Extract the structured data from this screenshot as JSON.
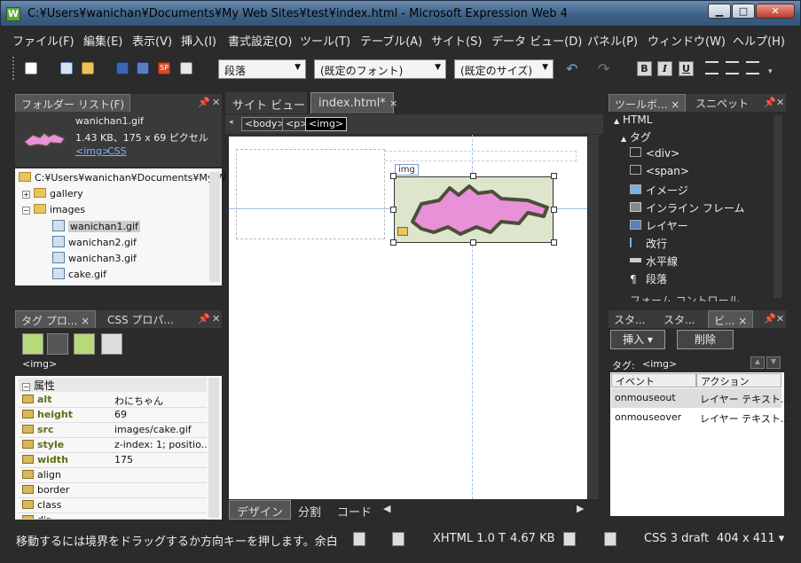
{
  "window": {
    "title": "C:¥Users¥wanichan¥Documents¥My Web Sites¥test¥index.html - Microsoft Expression Web 4",
    "app_icon_glyph": "W",
    "minimize": "▁",
    "maximize": "□",
    "close": "✕"
  },
  "menu": [
    "ファイル(F)",
    "編集(E)",
    "表示(V)",
    "挿入(I)",
    "書式設定(O)",
    "ツール(T)",
    "テーブル(A)",
    "サイト(S)",
    "データ ビュー(D)",
    "パネル(P)",
    "ウィンドウ(W)",
    "ヘルプ(H)"
  ],
  "toolbar": {
    "paragraph_combo": "段落",
    "font_combo": "(既定のフォント)",
    "size_combo": "(既定のサイズ)",
    "bold": "B",
    "italic": "I",
    "underline": "U",
    "overflow": "▾"
  },
  "folder_panel": {
    "tab": "フォルダー リスト(F)",
    "preview": {
      "filename": "wanichan1.gif",
      "info": "1.43 KB、175 x 69 ピクセル",
      "tag_link": "<img>",
      "css_link": "CSS"
    },
    "tree": [
      {
        "label": "C:¥Users¥wanichan¥Documents¥My W",
        "type": "folder-root"
      },
      {
        "label": "gallery",
        "type": "folder",
        "expander": "+"
      },
      {
        "label": "images",
        "type": "folder",
        "expander": "−"
      },
      {
        "label": "wanichan1.gif",
        "type": "file",
        "selected": true
      },
      {
        "label": "wanichan2.gif",
        "type": "file"
      },
      {
        "label": "wanichan3.gif",
        "type": "file"
      },
      {
        "label": "cake.gif",
        "type": "file"
      }
    ]
  },
  "tag_panel": {
    "tabs": [
      "タグ プロ...",
      "CSS プロパ..."
    ],
    "tag": "<img>",
    "group": "属性",
    "group_expander": "−",
    "rows": [
      {
        "name": "alt",
        "value": "わにちゃん",
        "bold": true
      },
      {
        "name": "height",
        "value": "69",
        "bold": true
      },
      {
        "name": "src",
        "value": "images/cake.gif",
        "bold": true
      },
      {
        "name": "style",
        "value": "z-index: 1; positio...",
        "bold": true
      },
      {
        "name": "width",
        "value": "175",
        "bold": true
      },
      {
        "name": "align",
        "value": "",
        "bold": false
      },
      {
        "name": "border",
        "value": "",
        "bold": false
      },
      {
        "name": "class",
        "value": "",
        "bold": false
      },
      {
        "name": "dir",
        "value": "",
        "bold": false
      }
    ]
  },
  "editor": {
    "tabs": [
      {
        "label": "サイト ビュー",
        "active": false
      },
      {
        "label": "index.html*",
        "active": true
      }
    ],
    "tab_close": "×",
    "breadcrumb": [
      "<body>",
      "<p>",
      "<img>"
    ],
    "image_label": "img",
    "view_tabs": [
      "デザイン",
      "分割",
      "コード"
    ]
  },
  "toolbox_panel": {
    "tabs": [
      "ツールボ...",
      "スニペット"
    ],
    "sections": [
      {
        "label": "HTML",
        "expander": "▲"
      },
      {
        "label": "タグ",
        "expander": "▲"
      }
    ],
    "items": [
      {
        "label": "<div>",
        "icon": "div-icon"
      },
      {
        "label": "<span>",
        "icon": "span-icon"
      },
      {
        "label": "イメージ",
        "icon": "image-icon"
      },
      {
        "label": "インライン フレーム",
        "icon": "iframe-icon"
      },
      {
        "label": "レイヤー",
        "icon": "layer-icon"
      },
      {
        "label": "改行",
        "icon": "break-icon"
      },
      {
        "label": "水平線",
        "icon": "hr-icon"
      },
      {
        "label": "段落",
        "icon": "paragraph-icon"
      }
    ],
    "cutoff": "フォーム コントロール"
  },
  "behavior_panel": {
    "tabs": [
      "スタ...",
      "スタ...",
      "ビ..."
    ],
    "insert": "挿入 ▾",
    "delete": "削除",
    "tag_label": "タグ:",
    "tag_value": "<img>",
    "headers": [
      "イベント",
      "アクション"
    ],
    "rows": [
      {
        "event": "onmouseout",
        "action": "レイヤー テキスト..."
      },
      {
        "event": "onmouseover",
        "action": "レイヤー テキスト..."
      }
    ]
  },
  "status": {
    "message": "移動するには境界をドラッグするか方向キーを押します。余白のサ",
    "doctype": "XHTML 1.0 T",
    "size": "4.67 KB",
    "css": "CSS 3 draft",
    "dimensions": "404 x 411 ▾"
  },
  "colors": {
    "chrome": "#2b2b2b",
    "accent": "#3d5f85",
    "image_fill": "#dde6cc",
    "croc_pink": "#e890d8",
    "croc_outline": "#4d4d3a"
  }
}
